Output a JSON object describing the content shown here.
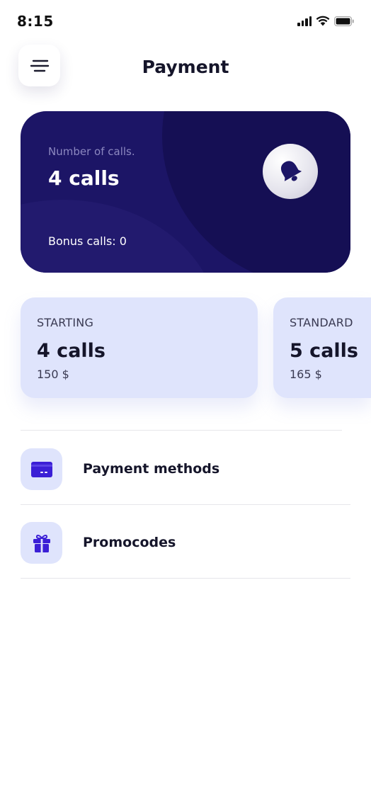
{
  "status_bar": {
    "time": "8:15",
    "icons": [
      "cellular-signal-icon",
      "wifi-icon",
      "battery-icon"
    ]
  },
  "header": {
    "title": "Payment",
    "menu_icon": "menu-icon"
  },
  "balance_card": {
    "label": "Number of calls.",
    "value": "4 calls",
    "bonus": "Bonus calls: 0",
    "icon": "bell-icon",
    "background_color": "#1c1566"
  },
  "plans": [
    {
      "name": "STARTING",
      "calls": "4 calls",
      "price": "150 $"
    },
    {
      "name": "STANDARD",
      "calls": "5 calls",
      "price": "165 $"
    }
  ],
  "menu": [
    {
      "label": "Payment methods",
      "icon": "credit-card-icon"
    },
    {
      "label": "Promocodes",
      "icon": "gift-icon"
    }
  ],
  "colors": {
    "accent": "#3b1fd6",
    "card_light": "#dfe4fc",
    "card_dark": "#1c1566"
  }
}
